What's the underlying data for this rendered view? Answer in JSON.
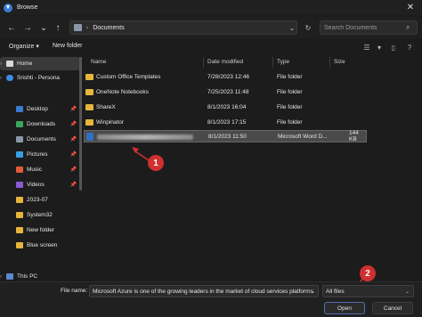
{
  "window": {
    "title": "Browse",
    "close_glyph": "✕"
  },
  "nav": {
    "back_glyph": "←",
    "forward_glyph": "→",
    "recent_glyph": "⌄",
    "up_glyph": "↑"
  },
  "address": {
    "separator": "›",
    "path": "Documents",
    "dropdown_glyph": "⌄",
    "refresh_glyph": "↻"
  },
  "search": {
    "placeholder": "Search Documents",
    "icon_glyph": "⌕"
  },
  "toolbar": {
    "organize_label": "Organize ▾",
    "new_folder_label": "New folder"
  },
  "sidebar": {
    "items": [
      {
        "label": "Home",
        "expand": "›",
        "color": "#d9d9d9",
        "selected": true
      },
      {
        "label": "Srishti - Persona",
        "expand": "›",
        "color": "#3a8ee6"
      },
      {
        "label": "Desktop",
        "pin": "📌",
        "color": "#3d7ad0"
      },
      {
        "label": "Downloads",
        "pin": "📌",
        "color": "#3aa55c"
      },
      {
        "label": "Documents",
        "pin": "📌",
        "color": "#8a96a8"
      },
      {
        "label": "Pictures",
        "pin": "📌",
        "color": "#3a9ee6"
      },
      {
        "label": "Music",
        "pin": "📌",
        "color": "#e05a3a"
      },
      {
        "label": "Videos",
        "pin": "📌",
        "color": "#8a5ad0"
      },
      {
        "label": "2023-07",
        "color": "#e7b53c"
      },
      {
        "label": "System32",
        "color": "#e7b53c"
      },
      {
        "label": "New folder",
        "color": "#e7b53c"
      },
      {
        "label": "Blue screen",
        "color": "#e7b53c"
      },
      {
        "label": "This PC",
        "expand": "›",
        "color": "#5a8ad0"
      }
    ]
  },
  "columns": {
    "name": "Name",
    "date": "Date modified",
    "type": "Type",
    "size": "Size"
  },
  "files": [
    {
      "name": "Custom Office Templates",
      "date": "7/28/2023 12:46",
      "type": "File folder",
      "size": ""
    },
    {
      "name": "OneNote Notebooks",
      "date": "7/25/2023 11:48",
      "type": "File folder",
      "size": ""
    },
    {
      "name": "ShareX",
      "date": "8/1/2023 16:04",
      "type": "File folder",
      "size": ""
    },
    {
      "name": "Winpinator",
      "date": "8/1/2023 17:15",
      "type": "File folder",
      "size": ""
    },
    {
      "name": "",
      "date": "8/1/2023 11:50",
      "type": "Microsoft Word D...",
      "size": "144 KB",
      "selected": true
    }
  ],
  "callouts": {
    "one": "1",
    "two": "2"
  },
  "bottom": {
    "file_name_label": "File name:",
    "file_name_value": "Microsoft Azure is one of the growing leaders in the market of cloud services platforms",
    "file_type": "All files",
    "open_label": "Open",
    "cancel_label": "Cancel",
    "dropdown_glyph": "⌄"
  },
  "colors": {
    "callout": "#d03030",
    "folder": "#e7b53c",
    "word_doc": "#2f6fc4",
    "accent_border": "#4f6fb0"
  }
}
